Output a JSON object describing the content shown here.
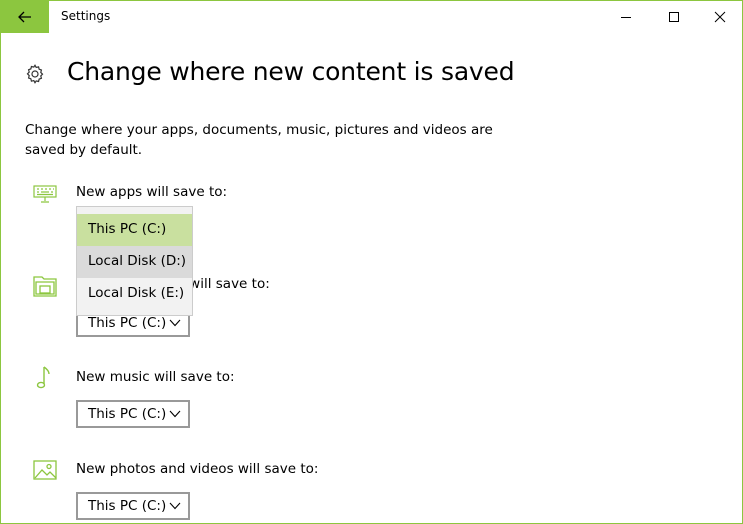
{
  "window": {
    "title": "Settings",
    "accent_color": "#8cc63f"
  },
  "header": {
    "title": "Change where new content is saved",
    "icon": "gear-icon"
  },
  "description": "Change where your apps, documents, music, pictures and videos are saved by default.",
  "sections": [
    {
      "icon": "monitor-keyboard-icon",
      "label": "New apps will save to:",
      "value": "This PC (C:)"
    },
    {
      "icon": "folder-documents-icon",
      "label": "New documents will save to:",
      "value": "This PC (C:)"
    },
    {
      "icon": "music-note-icon",
      "label": "New music will save to:",
      "value": "This PC (C:)"
    },
    {
      "icon": "photo-icon",
      "label": "New photos and videos will save to:",
      "value": "This PC (C:)"
    }
  ],
  "open_dropdown": {
    "options": [
      "This PC (C:)",
      "Local Disk (D:)",
      "Local Disk (E:)"
    ],
    "selected_color": "#c9e09f"
  }
}
